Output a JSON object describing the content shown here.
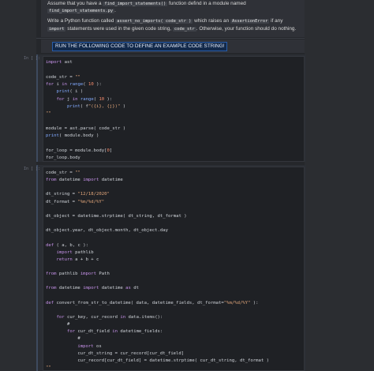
{
  "markdown": {
    "line1_pre": "Assume that you have a ",
    "line1_code": "find_import_statements()",
    "line1_post": " function defind in a module named",
    "line2_code": "find_import_statements.py",
    "line2_post": ".",
    "line3_pre": "Write a Python function called ",
    "line3_code1": "assert_no_imports( code_str )",
    "line3_mid": " which raises an ",
    "line3_code2": "AssertionError",
    "line3_post": " if any",
    "line4_code1": "import",
    "line4_mid": " statements were used in the given code string, ",
    "line4_code2": "code_str",
    "line4_post": ". Otherwise, your function should do nothing."
  },
  "banner": {
    "text": "RUN THE FOLLOWING CODE TO DEFINE AN EXAMPLE CODE STRING!"
  },
  "cell1": {
    "prompt": "In [ ]:",
    "lines": [
      "import ast",
      "",
      "code_str = \"\"\"",
      "for i in range( 10 ):",
      "    print( i )",
      "    for j in range( 10 ):",
      "        print( f\"({i}, {j})\" )",
      "\"\"\"",
      "",
      "module = ast.parse( code_str )",
      "print( module.body )",
      "",
      "for_loop = module.body[0]",
      "for_loop.body"
    ]
  },
  "cell2": {
    "prompt": "In [ ]:",
    "lines": [
      "code_str = \"\"\"",
      "from datetime import datetime",
      "",
      "dt_string = \"12/18/2020\"",
      "dt_format = \"%m/%d/%Y\"",
      "",
      "dt_object = datetime.strptime( dt_string, dt_format )",
      "",
      "dt_object.year, dt_object.month, dt_object.day",
      "",
      "def func1( a, b, c ):",
      "    import pathlib",
      "    return a + b + c",
      "",
      "from pathlib import Path",
      "",
      "from datetime import datetime as dt",
      "",
      "def convert_from_str_to_datetime( data, datetime_fields, dt_format=\"%m/%d/%Y\" ):",
      "",
      "    for cur_key, cur_record in data.items():",
      "        #",
      "        for cur_dt_field in datetime_fields:",
      "            #",
      "            import os",
      "            cur_dt_string = cur_record[cur_dt_field]",
      "            cur_record[cur_dt_field] = datetime.strptime( cur_dt_string, dt_format )",
      "\"\"\""
    ]
  }
}
